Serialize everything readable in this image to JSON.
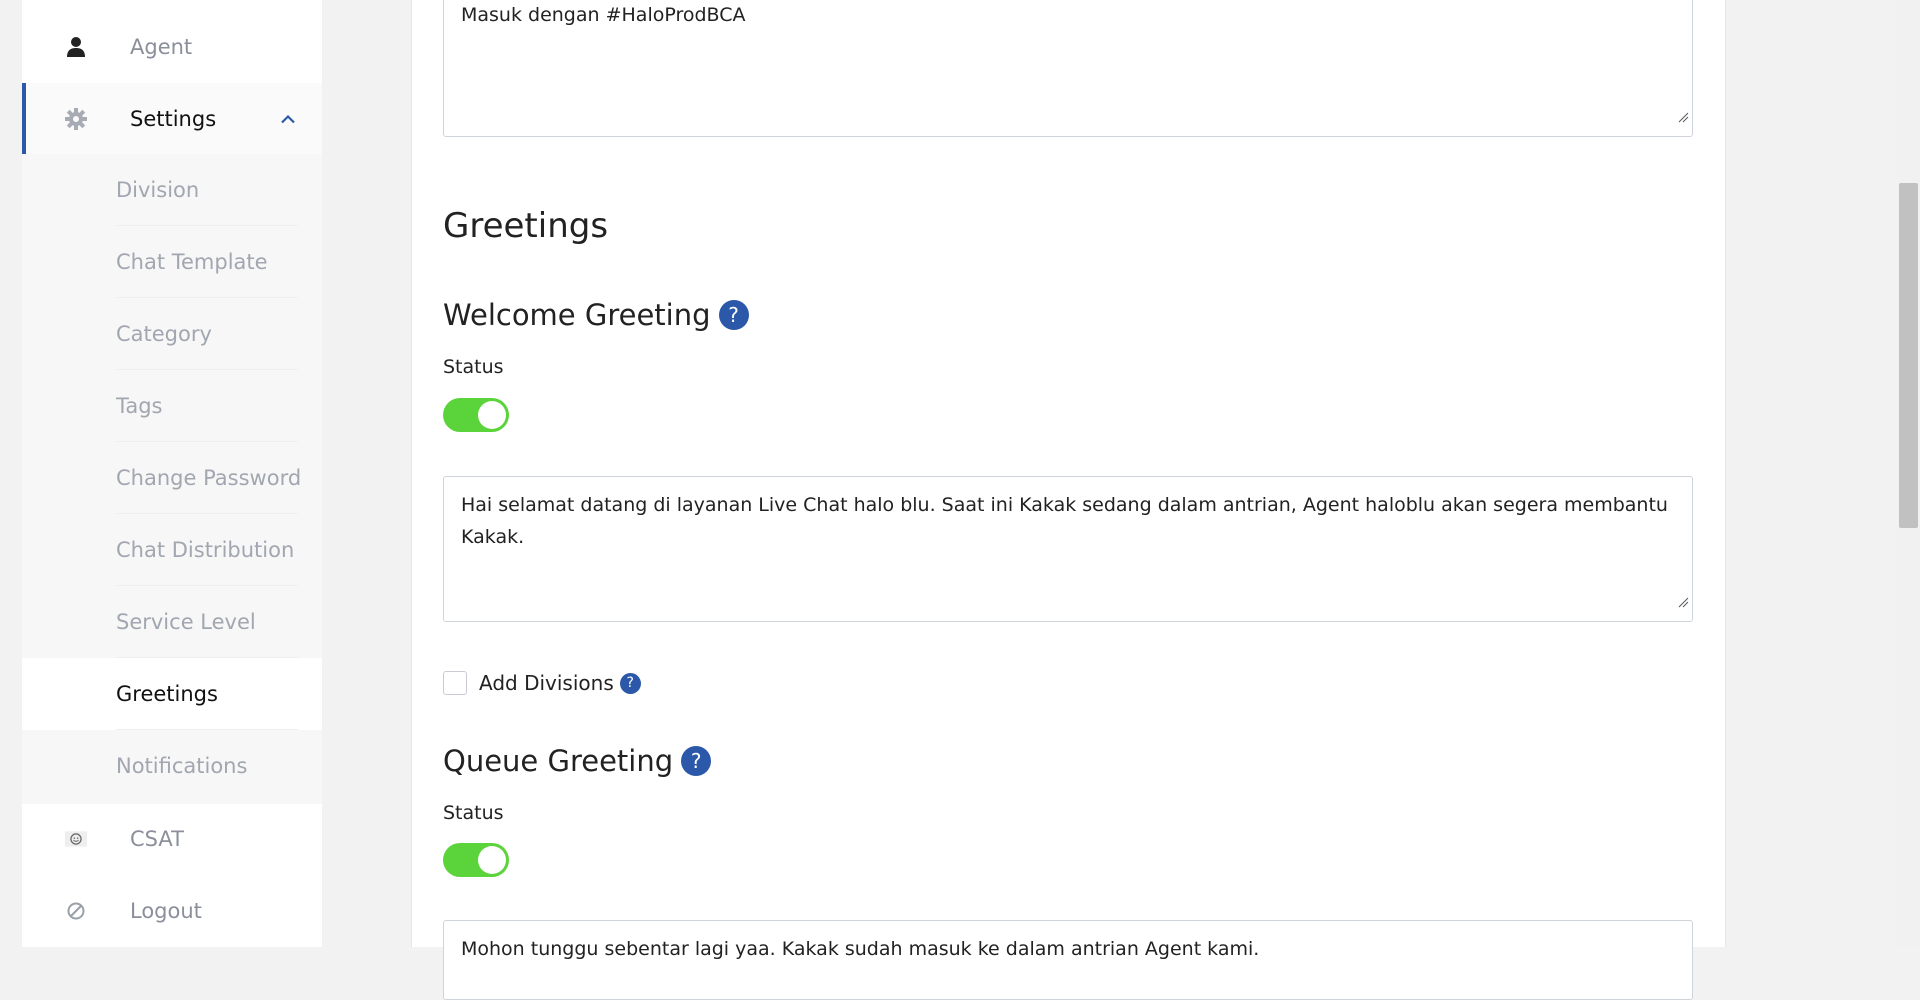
{
  "sidebar": {
    "agent_label": "Agent",
    "settings_label": "Settings",
    "csat_label": "CSAT",
    "logout_label": "Logout",
    "submenu": [
      {
        "label": "Division"
      },
      {
        "label": "Chat Template"
      },
      {
        "label": "Category"
      },
      {
        "label": "Tags"
      },
      {
        "label": "Change Password"
      },
      {
        "label": "Chat Distribution"
      },
      {
        "label": "Service Level"
      },
      {
        "label": "Greetings"
      },
      {
        "label": "Notifications"
      }
    ],
    "selected_submenu": "Greetings",
    "icons": {
      "agent": "person-icon",
      "settings": "gear-icon",
      "settings_chevron": "chevron-up-icon",
      "csat": "smiley-icon",
      "logout": "block-icon"
    }
  },
  "main": {
    "top_textarea_value": "Masuk dengan #HaloProdBCA",
    "section_title": "Greetings",
    "welcome": {
      "title": "Welcome Greeting",
      "help_icon": "question-icon",
      "status_label": "Status",
      "status_on": true,
      "message": "Hai selamat datang di layanan Live Chat halo blu. Saat ini Kakak sedang dalam antrian, Agent haloblu akan segera membantu Kakak."
    },
    "add_divisions": {
      "label": "Add Divisions",
      "checked": false,
      "help_icon": "question-icon"
    },
    "queue": {
      "title": "Queue Greeting",
      "help_icon": "question-icon",
      "status_label": "Status",
      "status_on": true,
      "message": "Mohon tunggu sebentar lagi yaa. Kakak sudah masuk ke dalam antrian Agent kami."
    }
  },
  "colors": {
    "accent": "#2b58a8",
    "toggle_on": "#5bd43b",
    "muted_text": "#a1a6b0"
  }
}
